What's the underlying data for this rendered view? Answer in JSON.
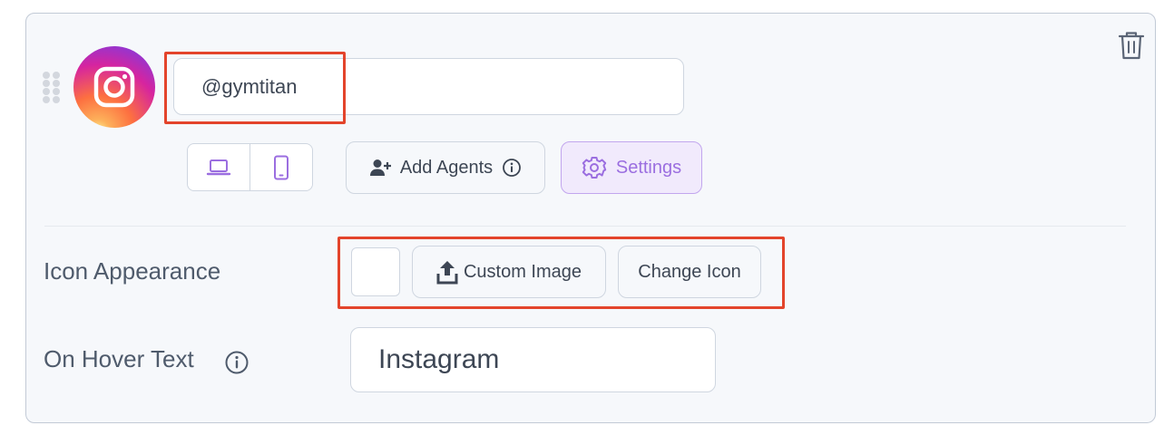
{
  "social": {
    "handle_value": "@gymtitan",
    "platform_icon": "instagram-icon",
    "brand_gradient": [
      "#fdf497",
      "#fd5949",
      "#d6249f",
      "#285aeb"
    ]
  },
  "device_toggle": {
    "desktop_icon": "laptop-icon",
    "mobile_icon": "smartphone-icon",
    "active_color": "#9b6ee0"
  },
  "actions": {
    "add_agents_label": "Add Agents",
    "settings_label": "Settings",
    "settings_accent": "#9b6ee0"
  },
  "icon_appearance": {
    "label": "Icon Appearance",
    "custom_image_label": "Custom Image",
    "change_icon_label": "Change Icon"
  },
  "hover_text": {
    "label": "On Hover Text",
    "value": "Instagram"
  },
  "highlight_color": "#e3442b"
}
